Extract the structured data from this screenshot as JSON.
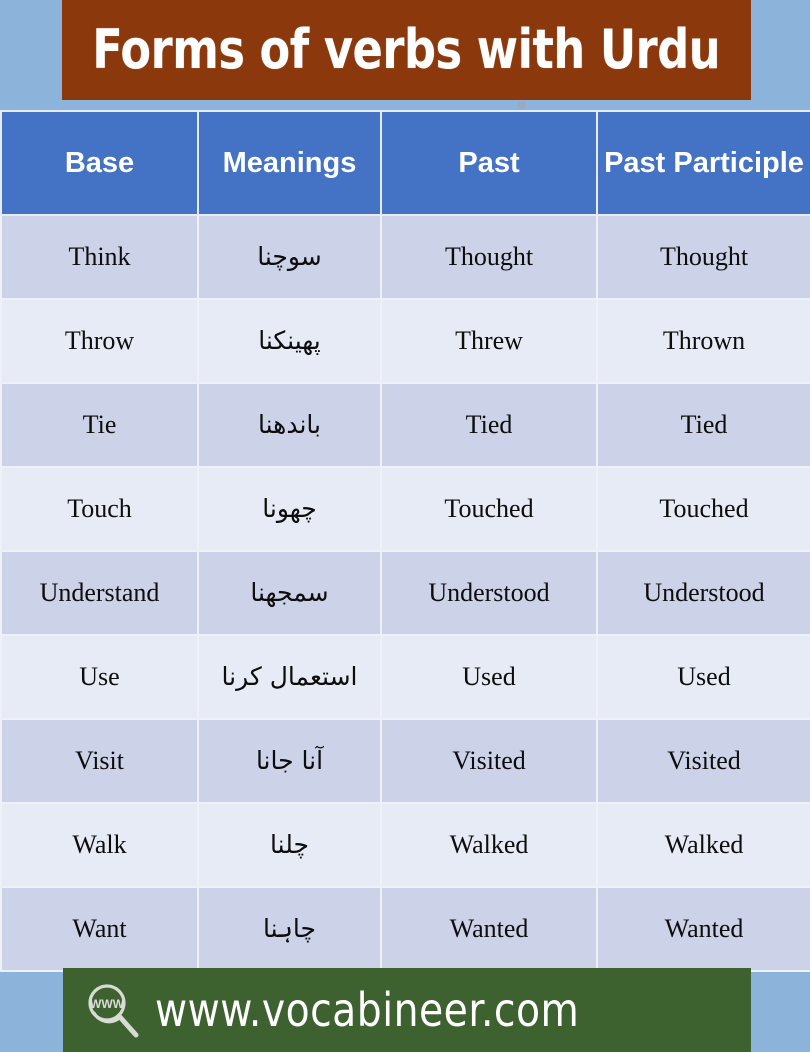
{
  "banner": {
    "title": "Forms of verbs with Urdu",
    "background_color": "#8a380c",
    "text_color": "#ffffff"
  },
  "table": {
    "header_background": "#4472c4",
    "header_text_color": "#ffffff",
    "row_odd_background": "#ccd2e8",
    "row_even_background": "#e7ebf5",
    "columns": [
      {
        "label": "Base"
      },
      {
        "label": "Meanings"
      },
      {
        "label": "Past"
      },
      {
        "label": "Past Participle"
      }
    ],
    "rows": [
      {
        "base": "Think",
        "meaning": "سوچنا",
        "past": "Thought",
        "past_participle": "Thought"
      },
      {
        "base": "Throw",
        "meaning": "پھینکنا",
        "past": "Threw",
        "past_participle": "Thrown"
      },
      {
        "base": "Tie",
        "meaning": "باندھنا",
        "past": "Tied",
        "past_participle": "Tied"
      },
      {
        "base": "Touch",
        "meaning": "چھونا",
        "past": "Touched",
        "past_participle": "Touched"
      },
      {
        "base": "Understand",
        "meaning": "سمجھنا",
        "past": "Understood",
        "past_participle": "Understood"
      },
      {
        "base": "Use",
        "meaning": "استعمال کرنا",
        "past": "Used",
        "past_participle": "Used"
      },
      {
        "base": "Visit",
        "meaning": "آنا جانا",
        "past": "Visited",
        "past_participle": "Visited"
      },
      {
        "base": "Walk",
        "meaning": "چلنا",
        "past": "Walked",
        "past_participle": "Walked"
      },
      {
        "base": "Want",
        "meaning": "چاہنا",
        "past": "Wanted",
        "past_participle": "Wanted"
      }
    ]
  },
  "footer": {
    "url": "www.vocabineer.com",
    "logo_label": "WWW",
    "background_color": "#3e6130",
    "text_color": "#ffffff"
  },
  "page": {
    "background_color": "#8cb3d9"
  }
}
